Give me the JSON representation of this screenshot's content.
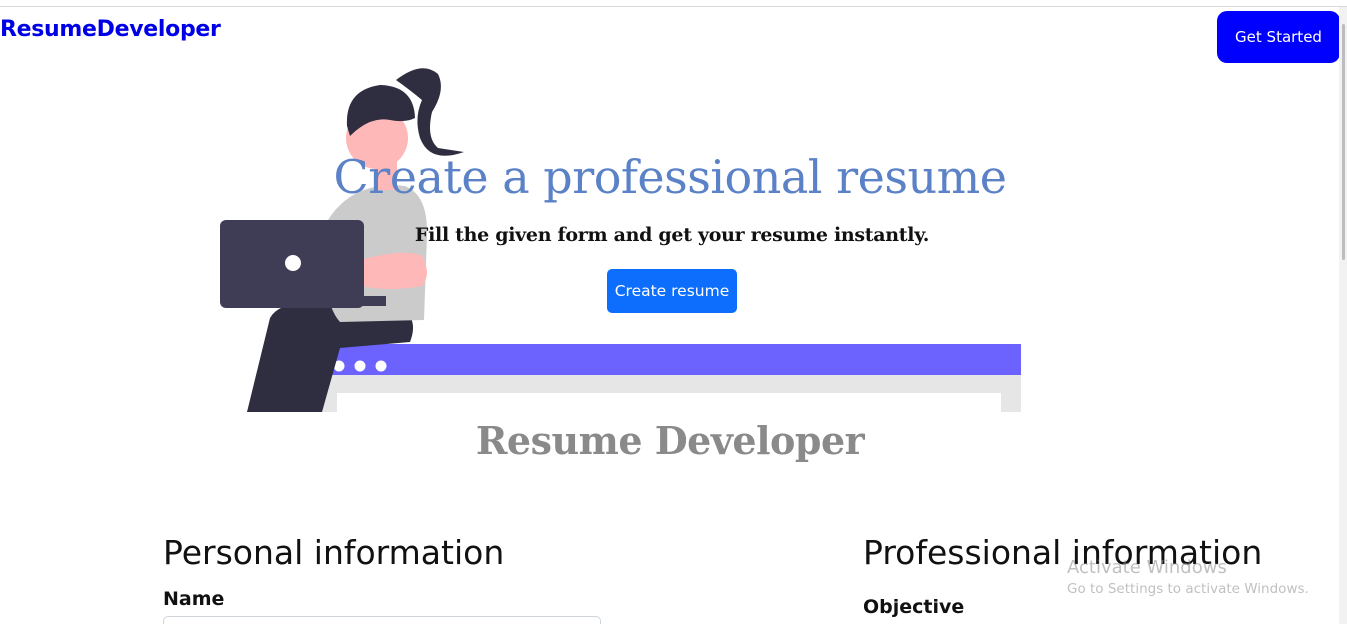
{
  "navbar": {
    "brand": "ResumeDeveloper",
    "cta_label": "Get Started"
  },
  "hero": {
    "title": "Create a professional resume",
    "subtitle": "Fill the given form and get your resume instantly.",
    "button_label": "Create resume",
    "illustration_icon": "woman-with-laptop-illustration"
  },
  "form": {
    "section_title": "Resume Developer",
    "personal": {
      "heading": "Personal information",
      "name_label": "Name",
      "name_value": "",
      "name_placeholder": ""
    },
    "professional": {
      "heading": "Professional information",
      "objective_label": "Objective"
    }
  },
  "os_watermark": {
    "title": "Activate Windows",
    "subtitle": "Go to Settings to activate Windows."
  },
  "colors": {
    "brand": "#0000e6",
    "cta_bg": "#0000ff",
    "primary_button": "#0d6efd",
    "hero_title": "#5b82c7",
    "section_title": "#8a8a8a",
    "illustration_accent": "#6c63ff",
    "illustration_dark": "#3f3d56"
  }
}
